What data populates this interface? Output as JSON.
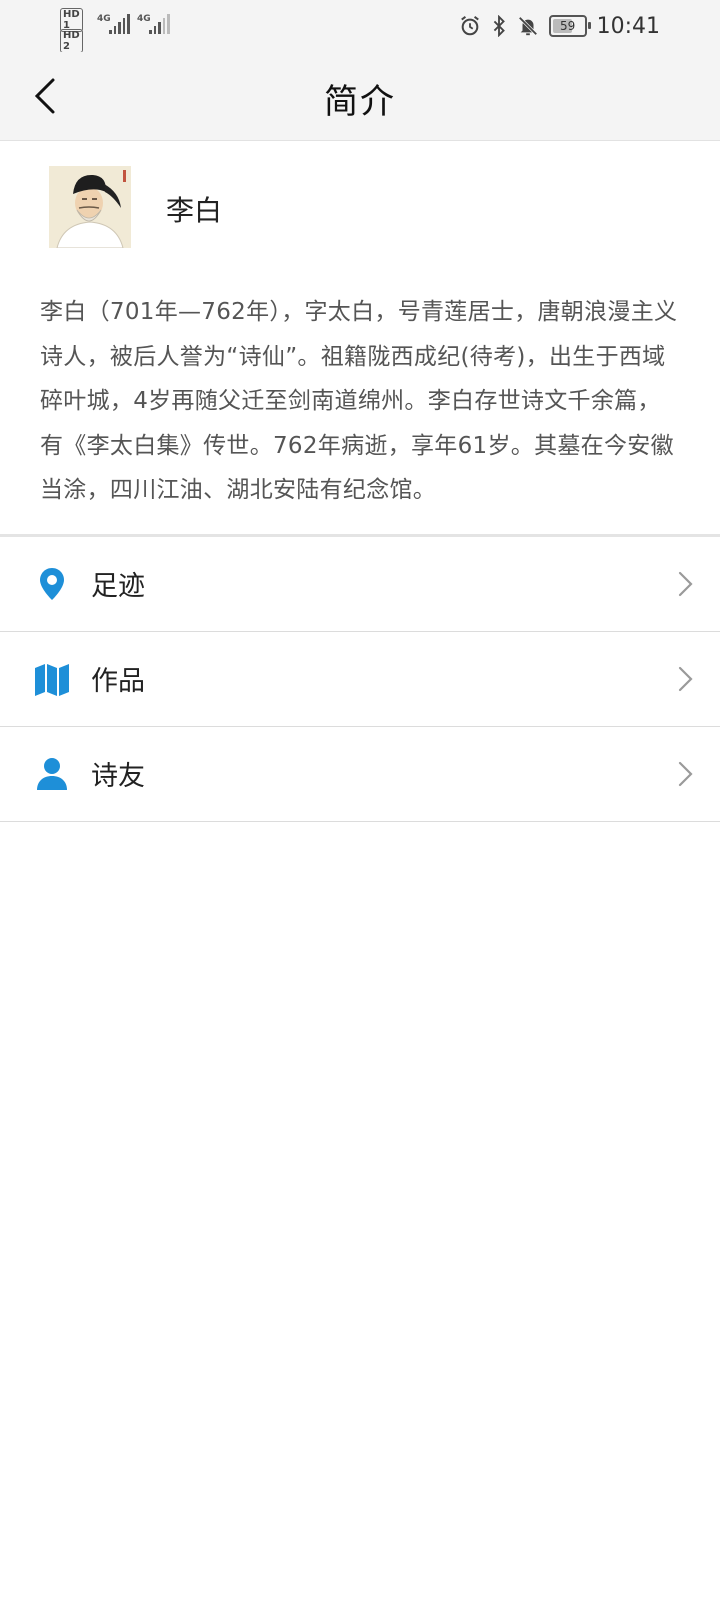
{
  "status_bar": {
    "time": "10:41",
    "battery": "59",
    "sim1_badge": "HD 1",
    "sim2_badge": "HD 2",
    "network1": "4G",
    "network2": "4G",
    "icons": [
      "alarm-icon",
      "bluetooth-icon",
      "bell-off-icon",
      "battery-icon"
    ]
  },
  "header": {
    "title": "简介",
    "back_icon": "chevron-left-icon"
  },
  "profile": {
    "name": "李白",
    "intro": "李白（701年—762年），字太白，号青莲居士，唐朝浪漫主义诗人，被后人誉为“诗仙”。祖籍陇西成纪(待考)，出生于西域碎叶城，4岁再随父迁至剑南道绵州。李白存世诗文千余篇，有《李太白集》传世。762年病逝，享年61岁。其墓在今安徽当涂，四川江油、湖北安陆有纪念馆。"
  },
  "menu": {
    "accent_color": "#1e8fd8",
    "items": [
      {
        "label": "足迹",
        "icon": "location-pin-icon"
      },
      {
        "label": "作品",
        "icon": "map-icon"
      },
      {
        "label": "诗友",
        "icon": "person-icon"
      }
    ]
  }
}
